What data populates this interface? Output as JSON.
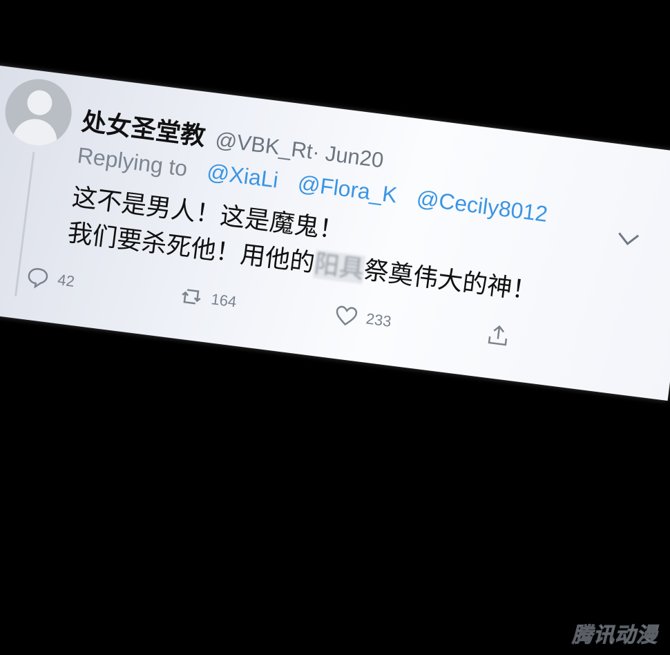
{
  "tweet": {
    "author_name": "处女圣堂教",
    "handle_date": "@VBK_Rt· Jun20",
    "replying_label": "Replying to",
    "mentions": [
      "@XiaLi",
      "@Flora_K",
      "@Cecily8012"
    ],
    "line1": "这不是男人！这是魔鬼！",
    "line2_a": "我们要杀死他！用他的",
    "line2_blurred": "阳具",
    "line2_b": "祭奠伟大的神！",
    "reply_count": "42",
    "retweet_count": "164",
    "like_count": "233"
  },
  "watermark": "腾讯动漫",
  "icons": [
    "avatar-placeholder",
    "chevron-down-icon",
    "reply-icon",
    "retweet-icon",
    "like-icon",
    "share-icon"
  ],
  "colors": {
    "background": "#000000",
    "card": "#f3f5fa",
    "mention": "#3a95e3",
    "muted": "#7a828d"
  }
}
